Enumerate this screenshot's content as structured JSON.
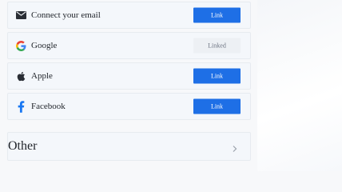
{
  "accounts": [
    {
      "icon": "email-icon",
      "label": "Connect your email",
      "button": "Link",
      "status": "link"
    },
    {
      "icon": "google-icon",
      "label": "Google",
      "button": "Linked",
      "status": "linked"
    },
    {
      "icon": "apple-icon",
      "label": "Apple",
      "button": "Link",
      "status": "link"
    },
    {
      "icon": "facebook-icon",
      "label": "Facebook",
      "button": "Link",
      "status": "link"
    }
  ],
  "other": {
    "label": "Other"
  },
  "colors": {
    "link_blue": "#1e6fe6",
    "linked_bg": "#edf0f4",
    "facebook_blue": "#1877f2"
  }
}
